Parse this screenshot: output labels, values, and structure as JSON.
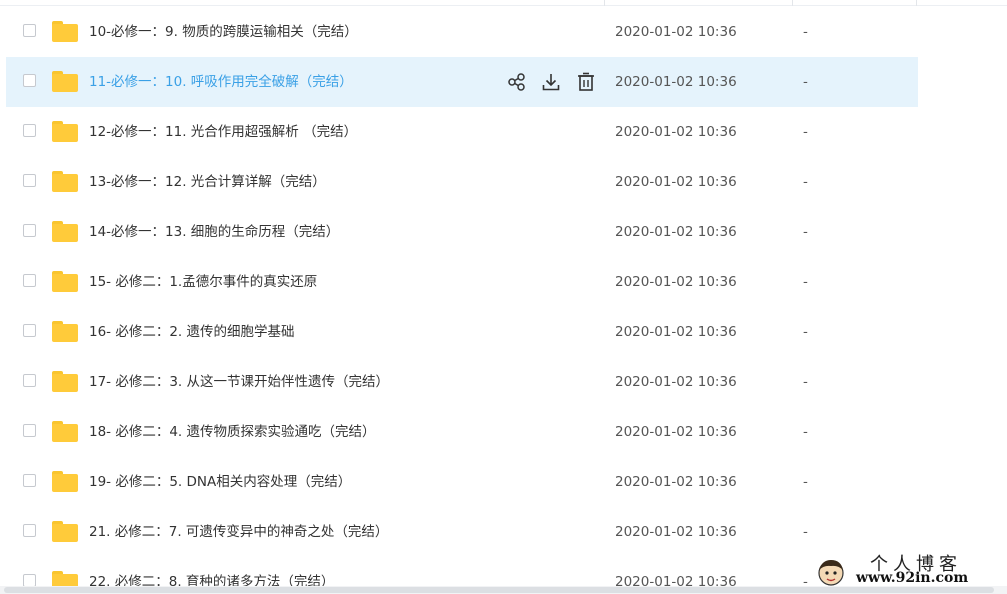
{
  "files": [
    {
      "name": "10-必修一：9. 物质的跨膜运输相关（完结）",
      "date": "2020-01-02 10:36",
      "size": "-"
    },
    {
      "name": "11-必修一：10. 呼吸作用完全破解（完结）",
      "date": "2020-01-02 10:36",
      "size": "-",
      "highlighted": true
    },
    {
      "name": "12-必修一：11. 光合作用超强解析 （完结）",
      "date": "2020-01-02 10:36",
      "size": "-"
    },
    {
      "name": "13-必修一：12. 光合计算详解（完结）",
      "date": "2020-01-02 10:36",
      "size": "-"
    },
    {
      "name": "14-必修一：13. 细胞的生命历程（完结）",
      "date": "2020-01-02 10:36",
      "size": "-"
    },
    {
      "name": "15- 必修二：1.孟德尔事件的真实还原",
      "date": "2020-01-02 10:36",
      "size": "-"
    },
    {
      "name": "16- 必修二：2. 遗传的细胞学基础",
      "date": "2020-01-02 10:36",
      "size": "-"
    },
    {
      "name": "17- 必修二：3. 从这一节课开始伴性遗传（完结）",
      "date": "2020-01-02 10:36",
      "size": "-"
    },
    {
      "name": "18- 必修二：4. 遗传物质探索实验通吃（完结）",
      "date": "2020-01-02 10:36",
      "size": "-"
    },
    {
      "name": "19- 必修二：5. DNA相关内容处理（完结）",
      "date": "2020-01-02 10:36",
      "size": "-"
    },
    {
      "name": "21. 必修二：7. 可遗传变异中的神奇之处（完结）",
      "date": "2020-01-02 10:36",
      "size": "-"
    },
    {
      "name": "22. 必修二：8. 育种的诸多方法（完结）",
      "date": "2020-01-02 10:36",
      "size": "-"
    }
  ],
  "row_actions": {
    "share_icon": "share-icon",
    "download_icon": "download-icon",
    "delete_icon": "trash-icon"
  },
  "watermark": {
    "title": "个人博客",
    "url": "www.92in.com"
  },
  "colors": {
    "highlight_bg": "#e5f3fc",
    "highlight_text": "#3aa0e6",
    "folder": "#ffcb3a"
  }
}
